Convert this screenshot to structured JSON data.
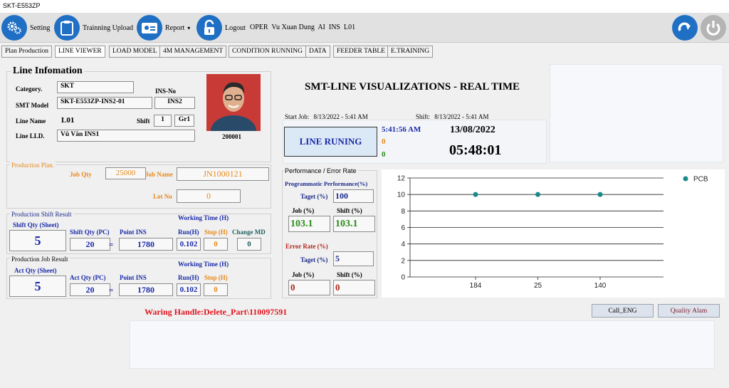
{
  "window": {
    "title": "SKT-E553ZP"
  },
  "toolbar": {
    "setting": "Setting",
    "training_upload": "Trainning Upload",
    "report": "Report",
    "report_arrow": "▾",
    "logout": "Logout",
    "user_info": "OPER  Vu Xuan Dung  AI  INS  L01"
  },
  "tabs": [
    "Plan Production",
    "LINE VIEWER",
    "LOAD MODEL",
    "4M MANAGEMENT",
    "CONDITION RUNNING",
    "DATA",
    "FEEDER TABLE",
    "E.TRAINING"
  ],
  "line_info": {
    "title": "Line Infomation",
    "category_label": "Category.",
    "category": "SKT",
    "ins_no_label": "INS-No",
    "smt_model_label": "SMT Model",
    "smt_model": "SKT-E553ZP-INS2-01",
    "ins_no": "INS2",
    "line_name_label": "Line Name",
    "line_name": "L01",
    "shift_label": "Shift",
    "shift": "1",
    "group": "Gr1",
    "line_lld_label": "Line LLD.",
    "line_lld": "Vũ Văn INS1",
    "employee_id": "200001"
  },
  "production_plan": {
    "title": "Production Plan.",
    "job_qty_label": "Job Qty",
    "job_qty": "25000",
    "job_name_label": "Job Name",
    "job_name": "JN1000121",
    "lot_no_label": "Lot No",
    "lot_no": "0"
  },
  "shift_result": {
    "title": "Production Shift  Result",
    "shift_qty_sheet_label": "Shift Qty (Sheet)",
    "shift_qty_sheet": "5",
    "shift_qty_pc_label": "Shift Qty (PC)",
    "shift_qty_pc": "20",
    "equals": "=",
    "point_ins_label": "Point INS",
    "point_ins": "1780",
    "working_time_label": "Working Time (H)",
    "run_label": "Run(H)",
    "run": "0.102",
    "stop_label": "Stop (H)",
    "stop": "0",
    "change_md_label": "Change MD",
    "change_md": "0"
  },
  "job_result": {
    "title": "Production Job  Result",
    "act_qty_sheet_label": "Act  Qty (Sheet)",
    "act_qty_sheet": "5",
    "act_qty_pc_label": "Act Qty (PC)",
    "act_qty_pc": "20",
    "equals": "=",
    "point_ins_label": "Point INS",
    "point_ins": "1780",
    "working_time_label": "Working Time (H)",
    "run_label": "Run(H)",
    "run": "0.102",
    "stop_label": "Stop (H)",
    "stop": "0"
  },
  "header": {
    "title": "SMT-LINE VISUALIZATIONS -  REAL TIME"
  },
  "status": {
    "start_job_label": "Start Job:",
    "start_job": "8/13/2022 - 5:41 AM",
    "shift_label": "Shift:",
    "shift_time": "8/13/2022 - 5:41 AM",
    "line_status": "LINE RUNING",
    "time_small": "5:41:56 AM",
    "count_red": "0",
    "count_green": "0",
    "date": "13/08/2022",
    "clock": "05:48:01"
  },
  "performance": {
    "title": "Performance / Error Rate",
    "prog_perf_label": "Programmatic Performance(%)",
    "target_label": "Taget (%)",
    "target": "100",
    "job_label": "Job (%)",
    "job": "103.1",
    "shift_label": "Shift (%)",
    "shift": "103.1",
    "error_rate_label": "Error Rate (%)",
    "err_target_label": "Taget (%)",
    "err_target": "5",
    "err_job_label": "Job (%)",
    "err_job": "0",
    "err_shift_label": "Shift (%)",
    "err_shift": "0"
  },
  "chart_data": {
    "type": "scatter",
    "categories": [
      "184",
      "25",
      "140"
    ],
    "series": [
      {
        "name": "PCB",
        "values": [
          10,
          10,
          10
        ]
      }
    ],
    "ylim": [
      0,
      12
    ],
    "yticks": [
      0,
      2,
      4,
      6,
      8,
      10,
      12
    ],
    "grid": true,
    "legend": "top-right",
    "color": "#1a8a8a"
  },
  "warning": {
    "text": "Waring Handle:Delete_Part\\110097591"
  },
  "buttons": {
    "call_eng": "Call_ENG",
    "quality_alarm": "Quality Alam"
  },
  "colors": {
    "accent": "#1f6fc5",
    "status_bg": "#dbe9f7",
    "warning": "#e0141e"
  }
}
